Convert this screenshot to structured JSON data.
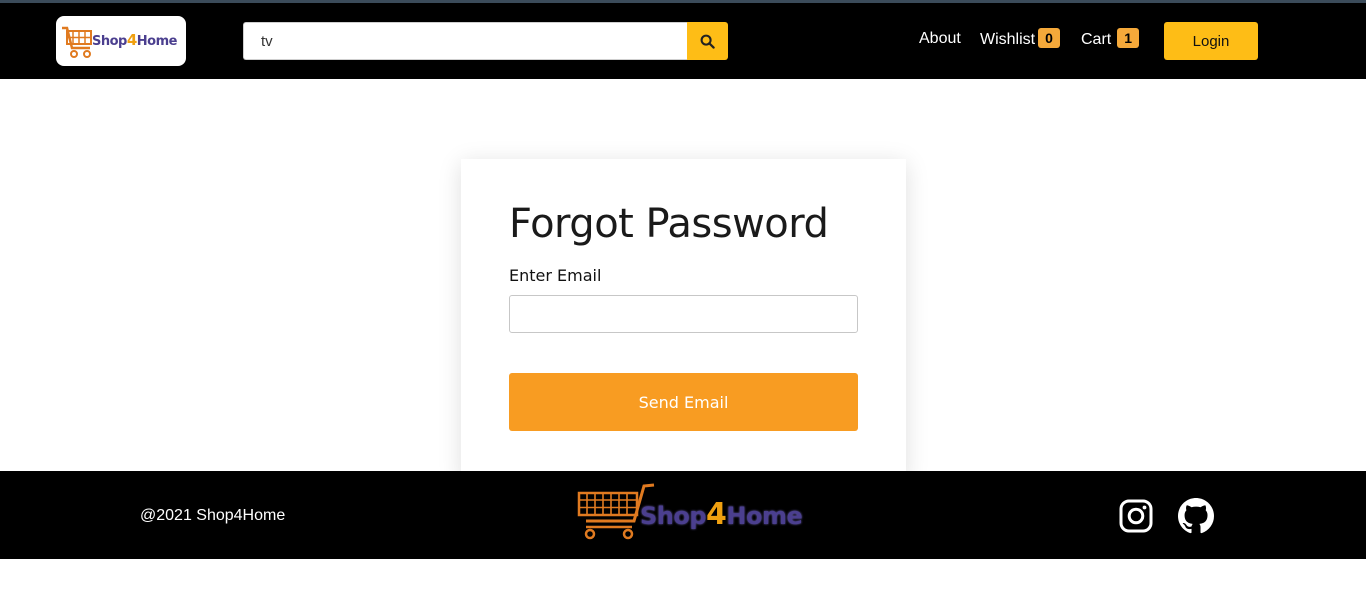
{
  "header": {
    "logo_brand_a": "Shop",
    "logo_brand_num": "4",
    "logo_brand_b": "Home",
    "search": {
      "value": "tv",
      "placeholder": ""
    },
    "nav": {
      "about": "About",
      "wishlist": "Wishlist",
      "wishlist_count": "0",
      "cart": "Cart",
      "cart_count": "1",
      "login": "Login"
    },
    "accent_color": "#febd16"
  },
  "form": {
    "title": "Forgot Password",
    "email_label": "Enter Email",
    "email_value": "",
    "submit_label": "Send Email",
    "submit_color": "#f89c22"
  },
  "footer": {
    "copyright": "@2021 Shop4Home",
    "logo_brand_a": "Shop",
    "logo_brand_num": "4",
    "logo_brand_b": "Home",
    "social_icons": [
      "instagram-icon",
      "github-icon"
    ]
  }
}
